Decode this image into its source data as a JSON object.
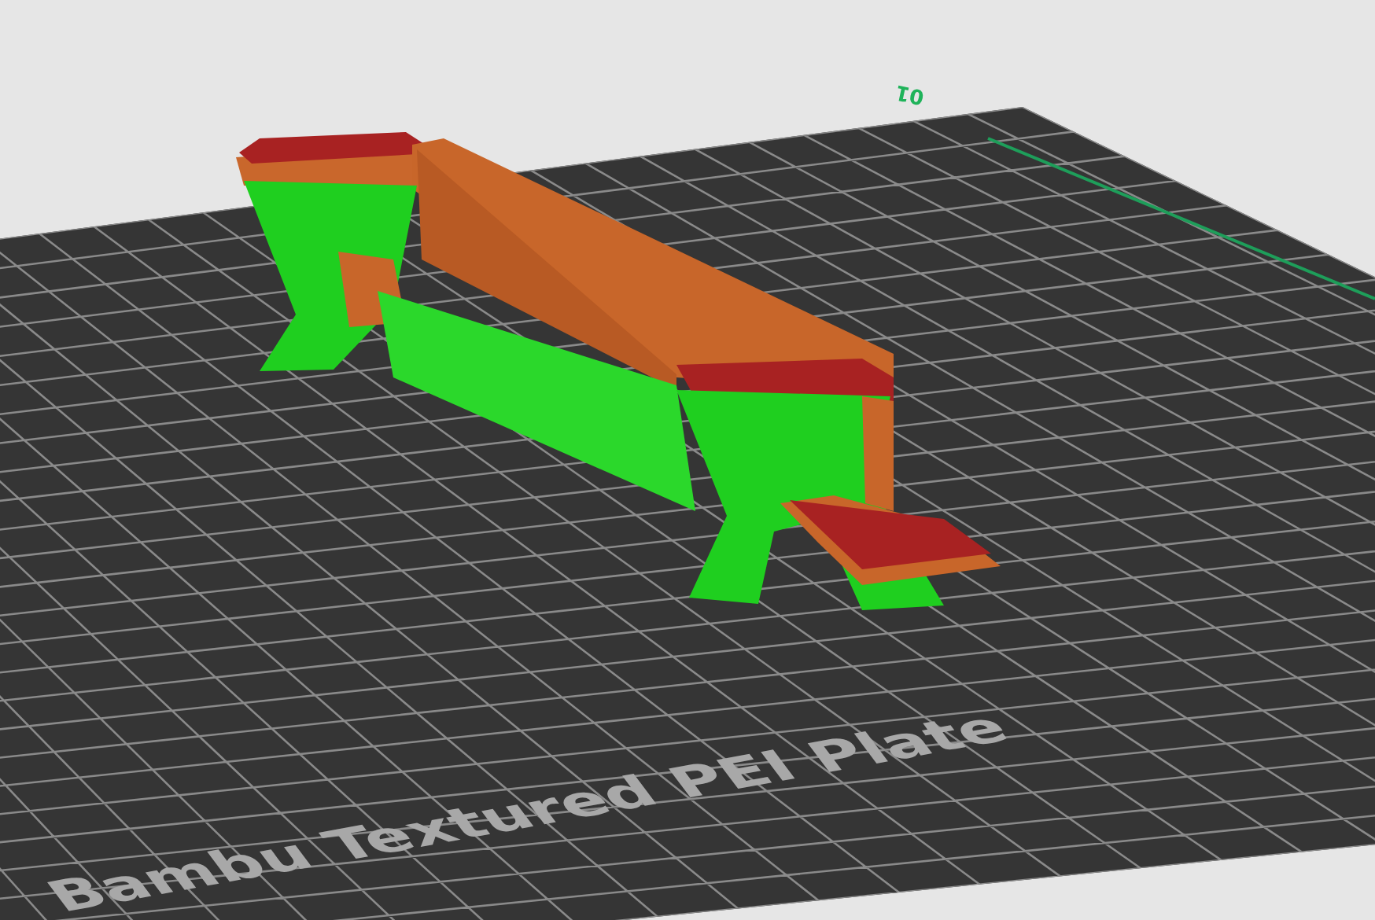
{
  "viewport": {
    "plate_number": "01",
    "plate_label": "Bambu Textured PEI Plate"
  }
}
